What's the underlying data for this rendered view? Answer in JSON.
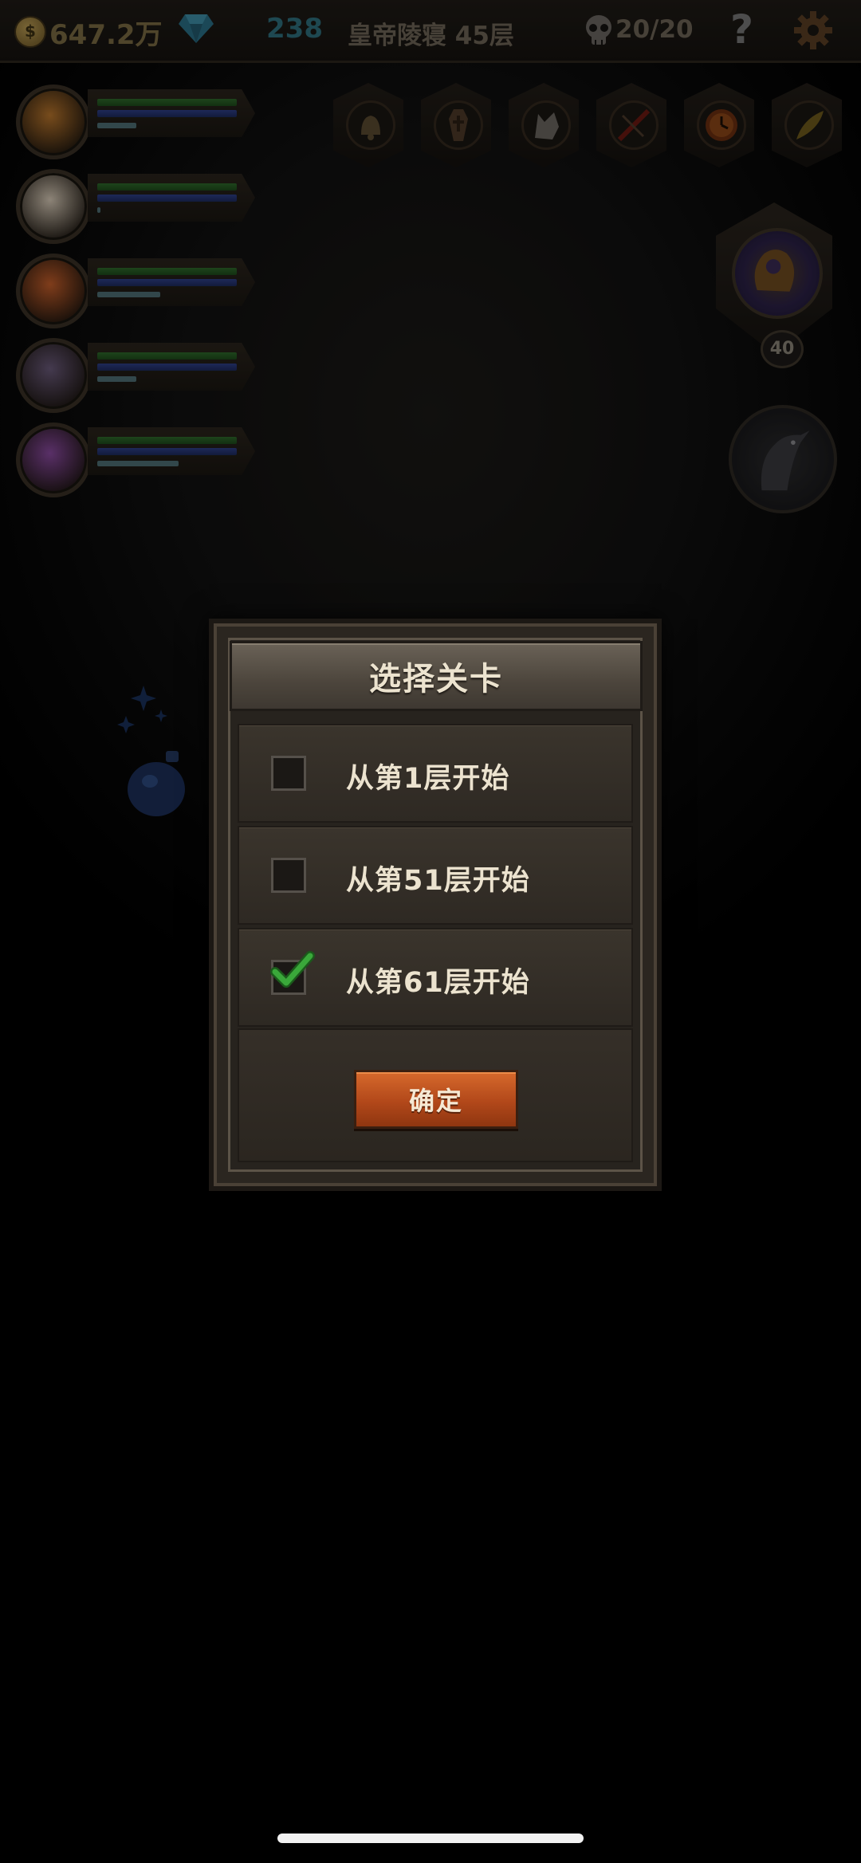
{
  "topbar": {
    "gold": "647.2万",
    "coin_symbol": "$",
    "gems": "238",
    "dungeon_floor": "皇帝陵寝 45层",
    "kills": "20/20",
    "help": "?"
  },
  "heroes": [
    {
      "name": "hero-1",
      "xp_fraction": 0.28,
      "color": "#b8752c"
    },
    {
      "name": "hero-2",
      "xp_fraction": 0.0,
      "color": "#d8cbb8"
    },
    {
      "name": "hero-3",
      "xp_fraction": 0.45,
      "color": "#c45e2a"
    },
    {
      "name": "hero-4",
      "xp_fraction": 0.28,
      "color": "#6a5a7a"
    },
    {
      "name": "hero-5",
      "xp_fraction": 0.58,
      "color": "#8a4aa0"
    }
  ],
  "items": [
    "bell-icon",
    "coffin-icon",
    "wolf-icon",
    "crossbow-icon",
    "clock-icon",
    "feather-icon"
  ],
  "boss": {
    "level": "40"
  },
  "dialog": {
    "title": "选择关卡",
    "options": [
      {
        "label": "从第1层开始",
        "checked": false
      },
      {
        "label": "从第51层开始",
        "checked": false
      },
      {
        "label": "从第61层开始",
        "checked": true
      }
    ],
    "confirm_label": "确定"
  },
  "colors": {
    "accent_orange": "#b2481a",
    "check_green": "#3aa83a",
    "hp_green": "#2e6a2b",
    "mp_blue": "#2e3f88"
  }
}
